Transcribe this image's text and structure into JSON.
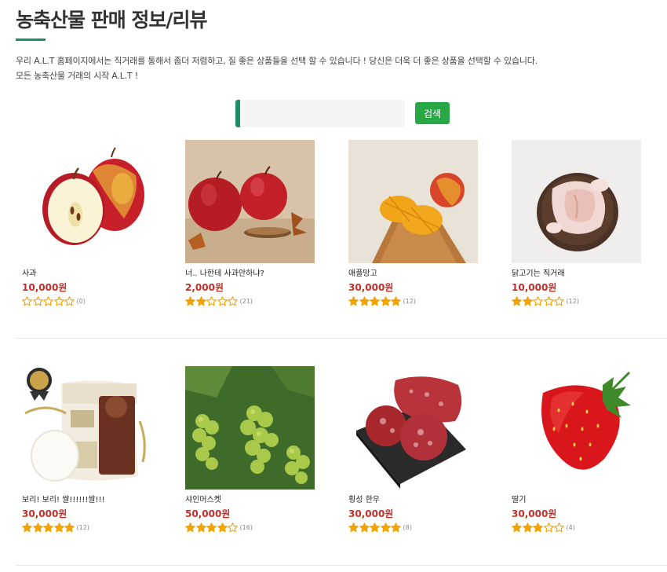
{
  "page": {
    "title": "농축산물 판매 정보/리뷰",
    "intro_line1": "우리 A.L.T 홈페이지에서는 직거래를 통해서 좀더 저렴하고, 질 좋은 상품들을 선택 할 수 있습니다 ! 당신은 더욱 더 좋은 상품을 선택할 수 있습니다.",
    "intro_line2": "모든 농축산물 거래의 시작 A.L.T !"
  },
  "search": {
    "placeholder": "",
    "value": "",
    "button_label": "검색"
  },
  "colors": {
    "accent": "#1a8f6a",
    "button": "#28a745",
    "price": "#c0302a",
    "star": "#f5a300"
  },
  "products": [
    {
      "name": "사과",
      "price": "10,000원",
      "rating": 0,
      "review_count": "(0)",
      "image": "apple"
    },
    {
      "name": "너.. 나한테 사과안하냐?",
      "price": "2,000원",
      "rating": 2,
      "review_count": "(21)",
      "image": "apples-on-cloth"
    },
    {
      "name": "애플망고",
      "price": "30,000원",
      "rating": 5,
      "review_count": "(12)",
      "image": "mango"
    },
    {
      "name": "닭고기는 직거래",
      "price": "10,000원",
      "rating": 2,
      "review_count": "(12)",
      "image": "chicken"
    },
    {
      "name": "보리! 보리! 쌀!!!!!!쌀!!!",
      "price": "30,000원",
      "rating": 5,
      "review_count": "(12)",
      "image": "rice-bag"
    },
    {
      "name": "샤인머스켓",
      "price": "50,000원",
      "rating": 4,
      "review_count": "(16)",
      "image": "grapes"
    },
    {
      "name": "횡성 한우",
      "price": "30,000원",
      "rating": 5,
      "review_count": "(8)",
      "image": "beef"
    },
    {
      "name": "딸기",
      "price": "30,000원",
      "rating": 3,
      "review_count": "(4)",
      "image": "strawberry"
    }
  ]
}
